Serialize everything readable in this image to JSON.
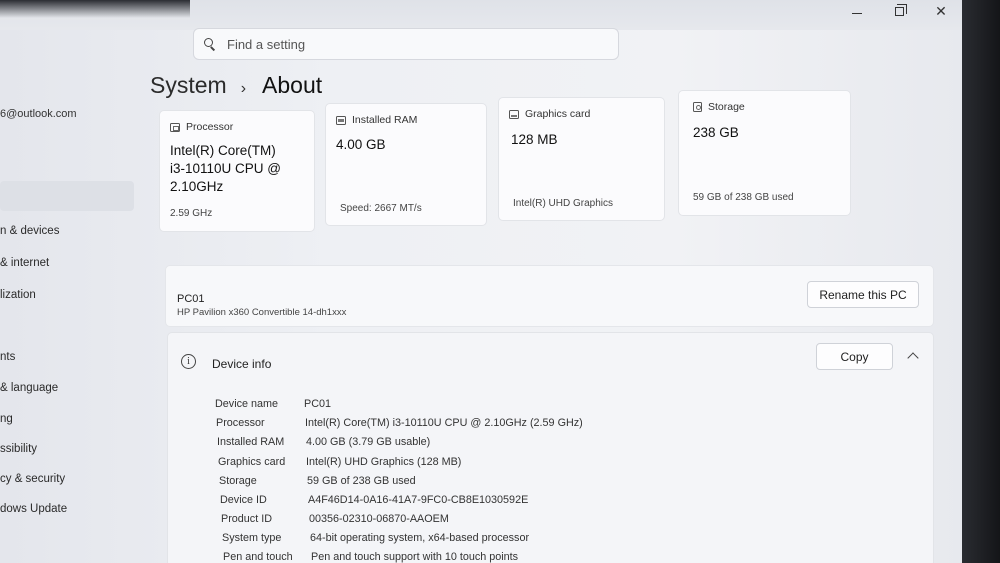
{
  "window": {
    "controls": {
      "minimize": "—",
      "restore": "",
      "close": "✕"
    }
  },
  "search": {
    "placeholder": "Find a setting"
  },
  "sidebar": {
    "account": "6@outlook.com",
    "items": [
      {
        "label": "n & devices"
      },
      {
        "label": "& internet"
      },
      {
        "label": "lization"
      },
      {
        "label": "nts"
      },
      {
        "label": "& language"
      },
      {
        "label": "ng"
      },
      {
        "label": "ssibility"
      },
      {
        "label": "cy & security"
      },
      {
        "label": "dows Update"
      }
    ]
  },
  "breadcrumb": {
    "root": "System",
    "separator": "›",
    "current": "About"
  },
  "cards": {
    "processor": {
      "label": "Processor",
      "value_lines": [
        "Intel(R) Core(TM)",
        "i3-10110U CPU @",
        "2.10GHz"
      ],
      "sub": "2.59 GHz"
    },
    "ram": {
      "label": "Installed RAM",
      "value": "4.00 GB",
      "sub": "Speed: 2667 MT/s"
    },
    "graphics": {
      "label": "Graphics card",
      "value": "128 MB",
      "sub": "Intel(R) UHD Graphics"
    },
    "storage": {
      "label": "Storage",
      "value": "238 GB",
      "sub": "59 GB of 238 GB used"
    }
  },
  "pc": {
    "name": "PC01",
    "model": "HP Pavilion x360 Convertible 14-dh1xxx",
    "rename_label": "Rename this PC"
  },
  "device_info": {
    "title": "Device info",
    "copy_label": "Copy",
    "rows": [
      {
        "label": "Device name",
        "value": "PC01"
      },
      {
        "label": "Processor",
        "value": "Intel(R) Core(TM) i3-10110U CPU @ 2.10GHz (2.59 GHz)"
      },
      {
        "label": "Installed RAM",
        "value": "4.00 GB (3.79 GB usable)"
      },
      {
        "label": "Graphics card",
        "value": "Intel(R) UHD Graphics (128 MB)"
      },
      {
        "label": "Storage",
        "value": "59 GB of 238 GB used"
      },
      {
        "label": "Device ID",
        "value": "A4F46D14-0A16-41A7-9FC0-CB8E1030592E"
      },
      {
        "label": "Product ID",
        "value": "00356-02310-06870-AAOEM"
      },
      {
        "label": "System type",
        "value": "64-bit operating system, x64-based processor"
      },
      {
        "label": "Pen and touch",
        "value": "Pen and touch support with 10 touch points"
      }
    ]
  }
}
